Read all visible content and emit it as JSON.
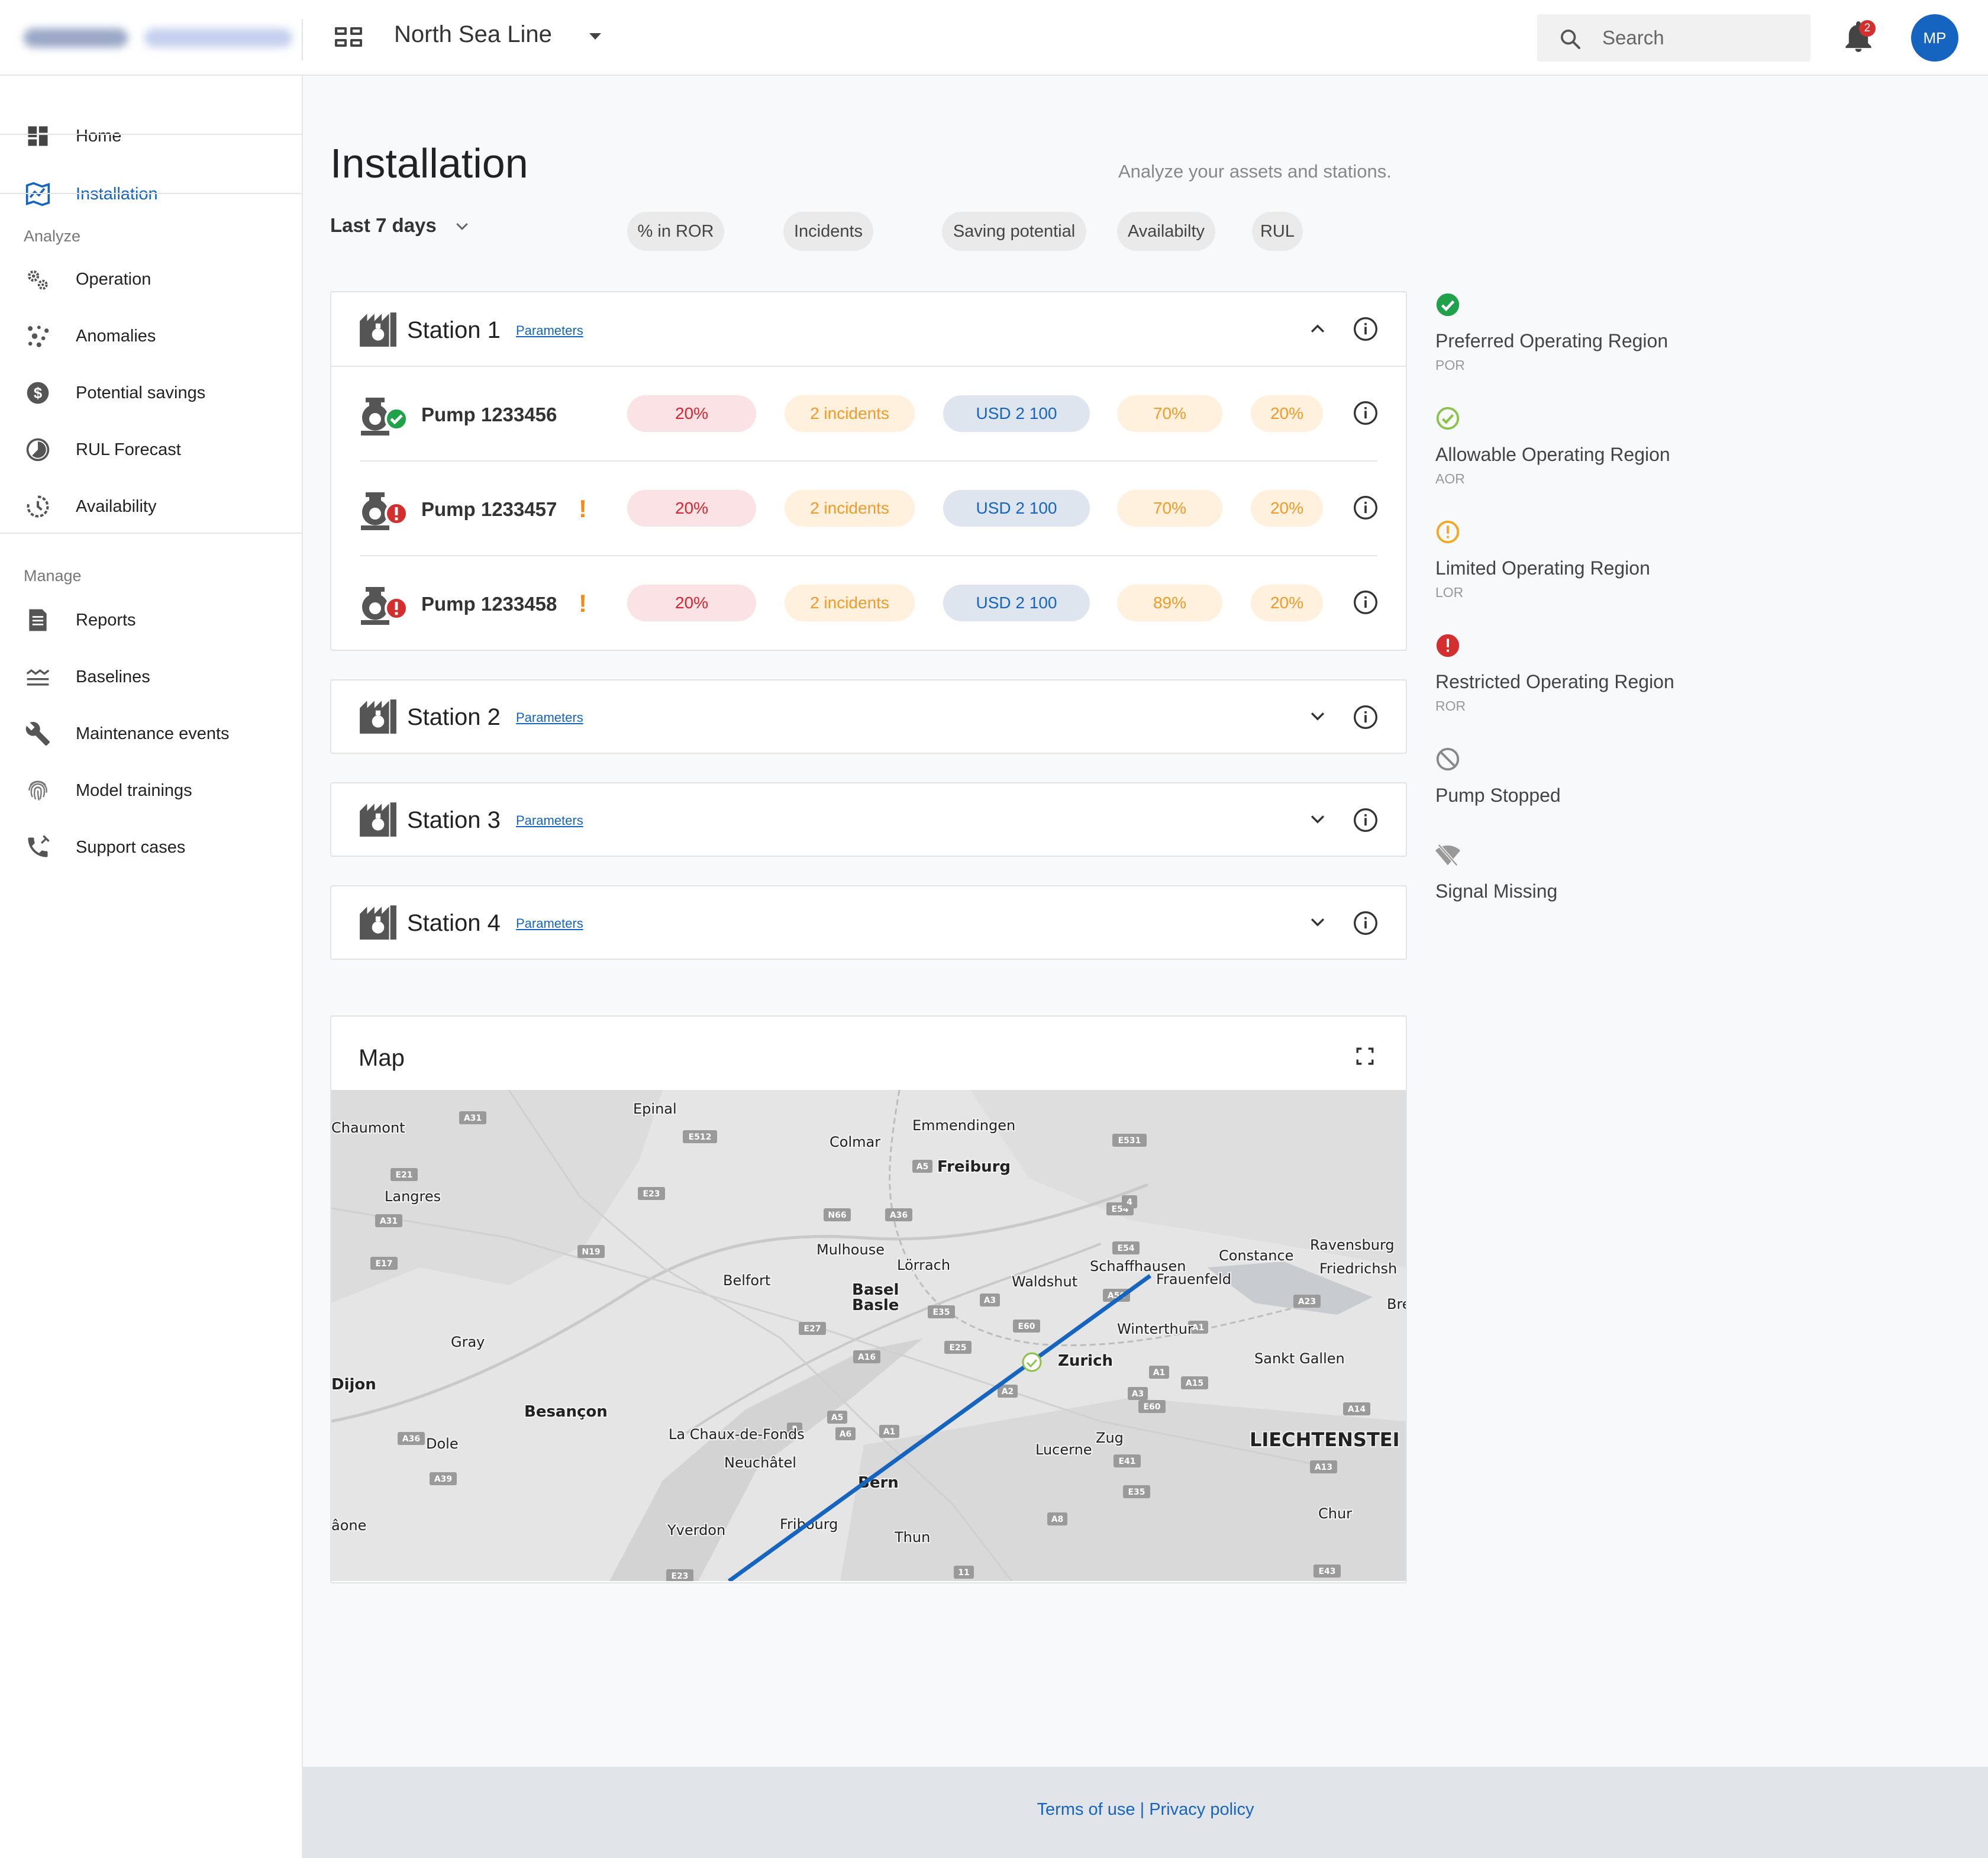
{
  "header": {
    "project_name": "North Sea Line",
    "search_placeholder": "Search",
    "notification_count": "2",
    "avatar_initials": "MP"
  },
  "sidebar": {
    "items_top": [
      {
        "label": "Home",
        "icon": "dashboard-icon"
      },
      {
        "label": "Installation",
        "icon": "installation-map-icon",
        "active": true
      }
    ],
    "analyze_title": "Analyze",
    "analyze_items": [
      {
        "label": "Operation",
        "icon": "gears-icon"
      },
      {
        "label": "Anomalies",
        "icon": "anomalies-dots-icon"
      },
      {
        "label": "Potential savings",
        "icon": "dollar-icon"
      },
      {
        "label": "RUL Forecast",
        "icon": "pie-timer-icon"
      },
      {
        "label": "Availability",
        "icon": "history-icon"
      }
    ],
    "manage_title": "Manage",
    "manage_items": [
      {
        "label": "Reports",
        "icon": "document-icon"
      },
      {
        "label": "Baselines",
        "icon": "baseline-lines-icon"
      },
      {
        "label": "Maintenance events",
        "icon": "wrench-icon"
      },
      {
        "label": "Model trainings",
        "icon": "fingerprint-icon"
      },
      {
        "label": "Support cases",
        "icon": "phone-icon"
      }
    ]
  },
  "main": {
    "title": "Installation",
    "subtitle": "Analyze your assets and stations.",
    "range_label": "Last 7 days",
    "columns": [
      "% in ROR",
      "Incidents",
      "Saving potential",
      "Availabilty",
      "RUL"
    ],
    "stations": [
      {
        "name": "Station 1",
        "parameters_link": "Parameters",
        "expanded": true,
        "pumps": [
          {
            "name": "Pump 1233456",
            "status": "preferred",
            "warning": "",
            "ror": "20%",
            "incidents": "2 incidents",
            "saving": "USD 2 100",
            "availability": "70%",
            "rul": "20%"
          },
          {
            "name": "Pump 1233457",
            "status": "restricted",
            "warning": "!",
            "ror": "20%",
            "incidents": "2 incidents",
            "saving": "USD 2 100",
            "availability": "70%",
            "rul": "20%"
          },
          {
            "name": "Pump 1233458",
            "status": "restricted",
            "warning": "!",
            "ror": "20%",
            "incidents": "2 incidents",
            "saving": "USD 2 100",
            "availability": "89%",
            "rul": "20%"
          }
        ]
      },
      {
        "name": "Station 2",
        "parameters_link": "Parameters",
        "expanded": false
      },
      {
        "name": "Station 3",
        "parameters_link": "Parameters",
        "expanded": false
      },
      {
        "name": "Station 4",
        "parameters_link": "Parameters",
        "expanded": false
      }
    ]
  },
  "legend": [
    {
      "label": "Preferred Operating Region",
      "abbr": "POR",
      "icon": "check-circle-filled-icon",
      "color": "#1fa24a"
    },
    {
      "label": "Allowable Operating Region",
      "abbr": "AOR",
      "icon": "check-circle-outline-icon",
      "color": "#8bc34a"
    },
    {
      "label": "Limited Operating Region",
      "abbr": "LOR",
      "icon": "alert-circle-outline-icon",
      "color": "#f5a623"
    },
    {
      "label": "Restricted Operating Region",
      "abbr": "ROR",
      "icon": "alert-circle-filled-icon",
      "color": "#d32f2f"
    },
    {
      "label": "Pump Stopped",
      "abbr": "",
      "icon": "blocked-icon",
      "color": "#888888"
    },
    {
      "label": "Signal Missing",
      "abbr": "",
      "icon": "signal-off-icon",
      "color": "#888888"
    }
  ],
  "map": {
    "title": "Map",
    "route_color": "#1565c0",
    "places": [
      {
        "name": "Epinal",
        "bold": false
      },
      {
        "name": "Chaumont",
        "bold": false
      },
      {
        "name": "Colmar",
        "bold": false
      },
      {
        "name": "Emmendingen",
        "bold": false
      },
      {
        "name": "Freiburg",
        "bold": true
      },
      {
        "name": "Langres",
        "bold": false
      },
      {
        "name": "Mulhouse",
        "bold": false
      },
      {
        "name": "Lörrach",
        "bold": false
      },
      {
        "name": "Belfort",
        "bold": false
      },
      {
        "name": "Basel",
        "bold": true
      },
      {
        "name": "Basle",
        "bold": true
      },
      {
        "name": "Waldshut",
        "bold": false
      },
      {
        "name": "Schaffhausen",
        "bold": false
      },
      {
        "name": "Constance",
        "bold": false
      },
      {
        "name": "Ravensburg",
        "bold": false
      },
      {
        "name": "Friedrichsh",
        "bold": false
      },
      {
        "name": "Frauenfeld",
        "bold": false
      },
      {
        "name": "Winterthur",
        "bold": false
      },
      {
        "name": "Bre",
        "bold": false
      },
      {
        "name": "Gray",
        "bold": false
      },
      {
        "name": "Zurich",
        "bold": true
      },
      {
        "name": "Sankt Gallen",
        "bold": false
      },
      {
        "name": "Dijon",
        "bold": true
      },
      {
        "name": "Besançon",
        "bold": true
      },
      {
        "name": "La Chaux-de-Fonds",
        "bold": false
      },
      {
        "name": "Dole",
        "bold": false
      },
      {
        "name": "Zug",
        "bold": false
      },
      {
        "name": "Lucerne",
        "bold": false
      },
      {
        "name": "LIECHTENSTEI",
        "bold": true
      },
      {
        "name": "Neuchâtel",
        "bold": false
      },
      {
        "name": "Bern",
        "bold": true
      },
      {
        "name": "Chur",
        "bold": false
      },
      {
        "name": "âone",
        "bold": false
      },
      {
        "name": "Yverdon",
        "bold": false
      },
      {
        "name": "Fribourg",
        "bold": false
      },
      {
        "name": "Thun",
        "bold": false
      }
    ],
    "road_shields": [
      "A31",
      "E512",
      "E531",
      "A5",
      "E21",
      "E23",
      "A31",
      "N66",
      "A36",
      "E54",
      "E17",
      "N19",
      "E54",
      "A3",
      "E35",
      "A50",
      "A23",
      "E27",
      "E25",
      "E60",
      "A1",
      "A16",
      "A15",
      "A1",
      "A2",
      "A3",
      "E60",
      "A5",
      "A6",
      "A14",
      "A36",
      "5",
      "A1",
      "E41",
      "A13",
      "A39",
      "E35",
      "A8",
      "E23",
      "11",
      "E43",
      "4"
    ]
  },
  "footer": {
    "terms": "Terms of use",
    "separator": "|",
    "privacy": "Privacy policy"
  }
}
